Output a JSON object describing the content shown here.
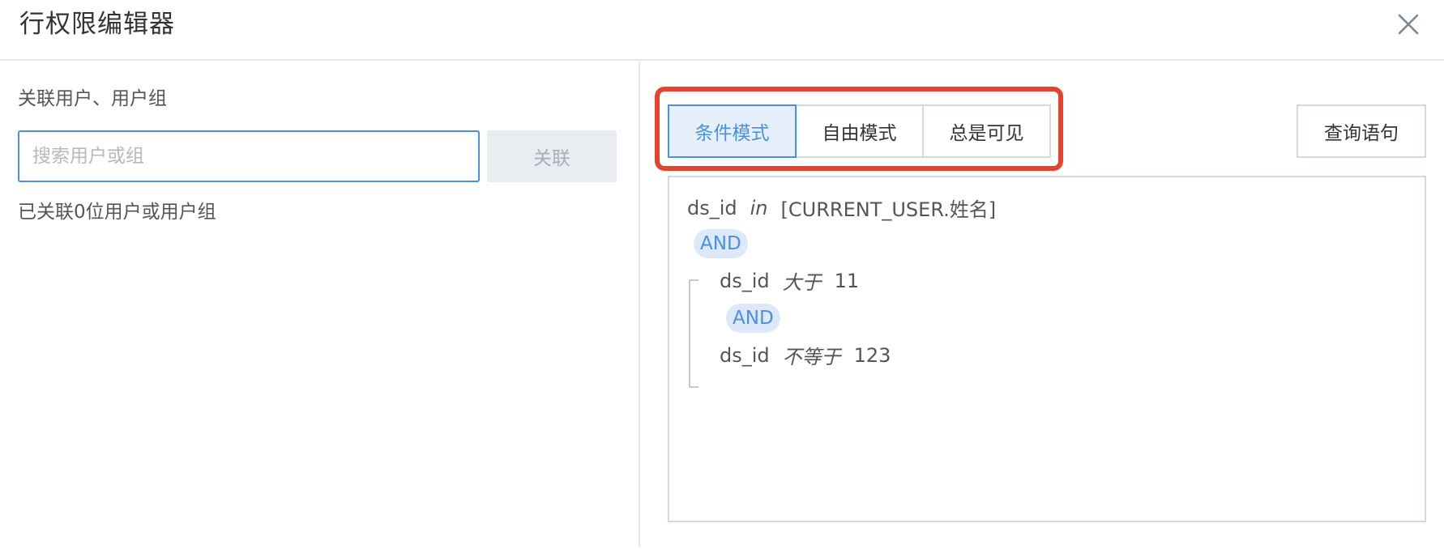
{
  "dialog": {
    "title": "行权限编辑器"
  },
  "left": {
    "label": "关联用户、用户组",
    "search": {
      "placeholder": "搜索用户或组",
      "value": ""
    },
    "link_button": "关联",
    "linked_count_text": "已关联0位用户或用户组"
  },
  "right": {
    "tabs": [
      {
        "label": "条件模式",
        "active": true
      },
      {
        "label": "自由模式",
        "active": false
      },
      {
        "label": "总是可见",
        "active": false
      }
    ],
    "query_button": "查询语句",
    "conditions": {
      "row1": {
        "field": "ds_id",
        "operator": "in",
        "value": "[CURRENT_USER.姓名]"
      },
      "and1": "AND",
      "group": {
        "row1": {
          "field": "ds_id",
          "operator": "大于",
          "value": "11"
        },
        "and": "AND",
        "row2": {
          "field": "ds_id",
          "operator": "不等于",
          "value": "123"
        }
      }
    }
  },
  "colors": {
    "accent": "#4a90e2",
    "highlight": "#e8422f",
    "active_tab_bg": "#e6f0fc",
    "and_badge_bg": "#dde9f8"
  },
  "icons": {
    "close": "close-icon"
  }
}
